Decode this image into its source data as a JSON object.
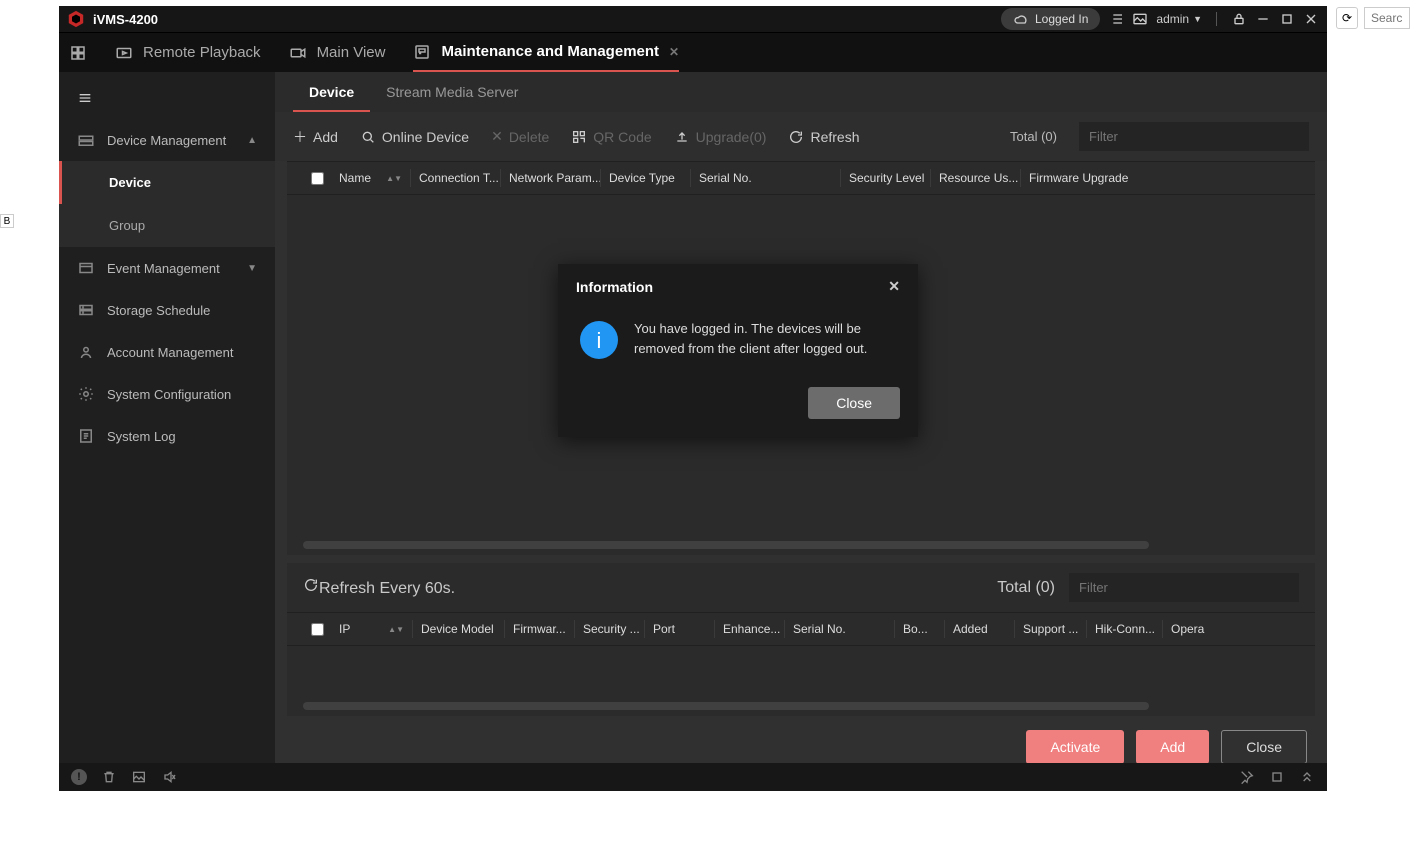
{
  "outer_cell": "B",
  "browser": {
    "refresh_title": "Refresh",
    "search_placeholder": "Search"
  },
  "titlebar": {
    "app_name": "iVMS-4200",
    "logged_in_label": "Logged In",
    "user": "admin"
  },
  "tabs": {
    "remote_playback": "Remote Playback",
    "main_view": "Main View",
    "maintenance": "Maintenance and Management"
  },
  "sidebar": {
    "device_management": "Device Management",
    "device": "Device",
    "group": "Group",
    "event_management": "Event Management",
    "storage_schedule": "Storage Schedule",
    "account_management": "Account Management",
    "system_configuration": "System Configuration",
    "system_log": "System Log"
  },
  "subtabs": {
    "device": "Device",
    "stream_media": "Stream Media Server"
  },
  "toolbar": {
    "add": "Add",
    "online_device": "Online Device",
    "delete": "Delete",
    "qr_code": "QR Code",
    "upgrade": "Upgrade(0)",
    "refresh": "Refresh",
    "total": "Total (0)",
    "filter_placeholder": "Filter"
  },
  "table_top_headers": {
    "name": "Name",
    "connection_type": "Connection T...",
    "network_param": "Network Param...",
    "device_type": "Device Type",
    "serial_no": "Serial No.",
    "security_level": "Security Level",
    "resource_usage": "Resource Us...",
    "firmware_upgrade": "Firmware Upgrade"
  },
  "panel2": {
    "refresh_every": "Refresh Every 60s.",
    "total": "Total (0)",
    "filter_placeholder": "Filter",
    "headers": {
      "ip": "IP",
      "device_model": "Device Model",
      "firmware": "Firmwar...",
      "security": "Security ...",
      "port": "Port",
      "enhance": "Enhance...",
      "serial_no": "Serial No.",
      "bo": "Bo...",
      "added": "Added",
      "support": "Support ...",
      "hik_connect": "Hik-Conn...",
      "operation": "Opera"
    }
  },
  "footer_btns": {
    "activate": "Activate",
    "add": "Add",
    "close": "Close"
  },
  "modal": {
    "title": "Information",
    "message": "You have logged in. The devices will be removed from the client after logged out.",
    "close": "Close"
  }
}
